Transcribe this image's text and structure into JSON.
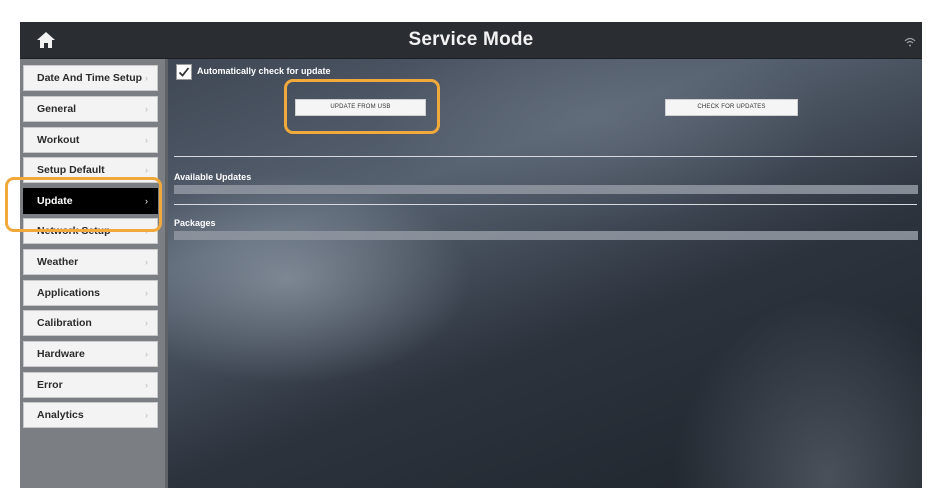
{
  "header": {
    "title": "Service Mode",
    "home_icon": "home-icon",
    "status_icon": "wifi-icon"
  },
  "sidebar": {
    "items": [
      {
        "label": "Date And Time Setup",
        "active": false
      },
      {
        "label": "General",
        "active": false
      },
      {
        "label": "Workout",
        "active": false
      },
      {
        "label": "Setup Default",
        "active": false
      },
      {
        "label": "Update",
        "active": true
      },
      {
        "label": "Network Setup",
        "active": false
      },
      {
        "label": "Weather",
        "active": false
      },
      {
        "label": "Applications",
        "active": false
      },
      {
        "label": "Calibration",
        "active": false
      },
      {
        "label": "Hardware",
        "active": false
      },
      {
        "label": "Error",
        "active": false
      },
      {
        "label": "Analytics",
        "active": false
      }
    ],
    "chevron": "›"
  },
  "update": {
    "auto_check_label": "Automatically check for update",
    "auto_check_checked": true,
    "update_from_usb_label": "UPDATE FROM USB",
    "check_for_updates_label": "CHECK FOR UPDATES",
    "available_updates_label": "Available Updates",
    "packages_label": "Packages"
  },
  "colors": {
    "highlight": "#f2a93b",
    "active_item": "#000000"
  }
}
